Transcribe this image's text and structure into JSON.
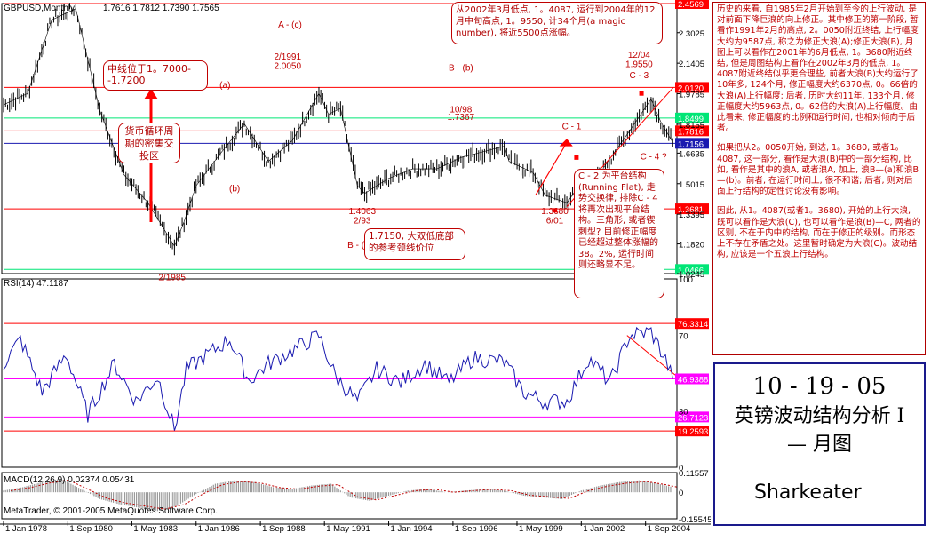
{
  "chart_data": [
    {
      "type": "line",
      "panel": "price",
      "symbol": "GBPUSD,Monthly",
      "ohlc_text": "1.7616 1.7812 1.7390 1.7565",
      "y_ticks": [
        "2.3025",
        "2.1405",
        "1.9785",
        "1.8165",
        "1.6635",
        "1.5015",
        "1.3395",
        "1.1820",
        "1.0245"
      ],
      "ylim": [
        1.0245,
        2.4569
      ],
      "x": [
        1978,
        1979,
        1980,
        1981,
        1982,
        1983,
        1984,
        1985.1,
        1985.5,
        1986,
        1987,
        1988,
        1989,
        1990,
        1991.1,
        1991.5,
        1992,
        1992.7,
        1993,
        1994,
        1995,
        1996,
        1997,
        1998.8,
        1999,
        2000,
        2000.5,
        2001.4,
        2001.8,
        2002.2,
        2003,
        2004,
        2004.9,
        2005.3,
        2005.8
      ],
      "values": [
        1.92,
        1.98,
        2.37,
        2.43,
        1.89,
        1.55,
        1.4,
        1.17,
        1.3,
        1.49,
        1.66,
        1.82,
        1.62,
        1.73,
        1.98,
        1.87,
        1.9,
        1.49,
        1.45,
        1.53,
        1.58,
        1.58,
        1.64,
        1.7,
        1.62,
        1.56,
        1.44,
        1.4,
        1.47,
        1.44,
        1.6,
        1.78,
        1.95,
        1.83,
        1.72
      ],
      "h_levels": [
        {
          "value": 2.4569,
          "label": "2.4569",
          "color": "#ff0000"
        },
        {
          "value": 2.012,
          "label": "2.0120",
          "color": "#ff0000"
        },
        {
          "value": 1.8499,
          "label": "1.8499",
          "color": "#00e676"
        },
        {
          "value": 1.7816,
          "label": "1.7816",
          "color": "#ff0000"
        },
        {
          "value": 1.7156,
          "label": "1.7156",
          "color": "#1a1ab0"
        },
        {
          "value": 1.3681,
          "label": "1.3681",
          "color": "#ff0000"
        },
        {
          "value": 1.0466,
          "label": "1.0466",
          "color": "#00e676"
        }
      ],
      "annotations": [
        {
          "text": "A - (c)",
          "x": 1989.9,
          "y": 2.33
        },
        {
          "text": "2/1991",
          "x": 1989.8,
          "y": 2.16
        },
        {
          "text": "2.0050",
          "x": 1989.8,
          "y": 2.11
        },
        {
          "text": "(a)",
          "x": 1987.2,
          "y": 2.01
        },
        {
          "text": "(b)",
          "x": 1987.6,
          "y": 1.46
        },
        {
          "text": "B - (b)",
          "x": 1997.0,
          "y": 2.1
        },
        {
          "text": "10/98",
          "x": 1997.0,
          "y": 1.88
        },
        {
          "text": "1.7367",
          "x": 1997.0,
          "y": 1.84
        },
        {
          "text": "C - 1",
          "x": 2001.6,
          "y": 1.79
        },
        {
          "text": "12/04",
          "x": 2004.4,
          "y": 2.17
        },
        {
          "text": "1.9550",
          "x": 2004.4,
          "y": 2.12
        },
        {
          "text": "C - 3",
          "x": 2004.4,
          "y": 2.06
        },
        {
          "text": "C - 4 ?",
          "x": 2005.0,
          "y": 1.63
        },
        {
          "text": "C - 2",
          "x": 2003.6,
          "y": 1.48
        },
        {
          "text": "1.4063",
          "x": 1992.9,
          "y": 1.34
        },
        {
          "text": "2/93",
          "x": 1992.9,
          "y": 1.29
        },
        {
          "text": "B - (a)",
          "x": 1992.8,
          "y": 1.16
        },
        {
          "text": "1.3680",
          "x": 2000.9,
          "y": 1.34
        },
        {
          "text": "6/01",
          "x": 2000.9,
          "y": 1.29
        },
        {
          "text": "1.4087",
          "x": 2002.4,
          "y": 1.34
        },
        {
          "text": "3/02",
          "x": 2002.4,
          "y": 1.29
        },
        {
          "text": "B - (c)",
          "x": 2002.6,
          "y": 1.14
        },
        {
          "text": "2/1985",
          "x": 1985.0,
          "y": 0.99
        }
      ],
      "notes": {
        "mid_line": "中线位于1。7000--1.7200",
        "cycle": "货币循环周期的密集交投区",
        "neckline": "1.7150, 大双低底部的参考颈线价位",
        "c2_note": "C - 2 为平台结构(Running Flat), 走势交换律, 排除C - 4 将再次出现平台结构。三角形, 或者锲刺型? 目前修正幅度已经超过整体涨幅的 38。2%, 运行时间则还略显不足。",
        "top_note": "从2002年3月低点, 1。4087, 运行到2004年的12月中旬高点, 1。9550, 计34个月(a magic number), 将近5500点涨幅。"
      }
    },
    {
      "type": "line",
      "panel": "rsi",
      "title": "RSI(14) 47.1187",
      "y_ticks": [
        "100",
        "70",
        "30",
        "0"
      ],
      "ylim": [
        0,
        100
      ],
      "levels": [
        {
          "value": 76.3314,
          "label": "76.3314",
          "color": "#ff0000"
        },
        {
          "value": 46.9388,
          "label": "46.9388",
          "color": "#ff00ff"
        },
        {
          "value": 26.7123,
          "label": "26.7123",
          "color": "#ff00ff"
        },
        {
          "value": 19.2593,
          "label": "19.2593",
          "color": "#ff0000"
        }
      ],
      "x": [
        1978,
        1978.7,
        1979.6,
        1980.6,
        1981.5,
        1982.6,
        1983.5,
        1984.4,
        1985.1,
        1985.6,
        1986.5,
        1987.4,
        1988.2,
        1989.0,
        1990.0,
        1991.1,
        1991.8,
        1992.7,
        1993.5,
        1994.5,
        1995.5,
        1996.5,
        1997.5,
        1998.8,
        1999.6,
        2000.4,
        2001.4,
        2002.3,
        2003.2,
        2004.0,
        2004.9,
        2005.5,
        2005.8
      ],
      "values": [
        55,
        68,
        40,
        60,
        28,
        55,
        35,
        48,
        20,
        52,
        60,
        68,
        46,
        55,
        62,
        70,
        48,
        35,
        52,
        45,
        55,
        45,
        58,
        56,
        40,
        35,
        35,
        58,
        45,
        70,
        72,
        57,
        47
      ]
    },
    {
      "type": "bar",
      "panel": "macd",
      "title": "MACD(12,26,9) 0.02374 0.05431",
      "y_ticks": [
        "0.11557",
        "0",
        "-0.15545"
      ],
      "ylim": [
        -0.15545,
        0.11557
      ],
      "x": [
        1978,
        1978.8,
        1979.6,
        1980.4,
        1981.2,
        1982.0,
        1982.8,
        1983.6,
        1984.4,
        1985.2,
        1986.0,
        1986.8,
        1987.6,
        1988.4,
        1989.2,
        1990.0,
        1990.8,
        1991.6,
        1992.4,
        1993.2,
        1994.0,
        1994.8,
        1995.6,
        1996.4,
        1997.2,
        1998.0,
        1998.8,
        1999.6,
        2000.4,
        2001.2,
        2002.0,
        2002.8,
        2003.6,
        2004.4,
        2005.2,
        2005.8
      ],
      "values": [
        0.01,
        0.03,
        0.06,
        0.08,
        0.02,
        -0.04,
        -0.07,
        -0.09,
        -0.11,
        -0.08,
        -0.01,
        0.05,
        0.07,
        0.06,
        0.03,
        0.02,
        0.04,
        0.05,
        -0.03,
        -0.05,
        -0.02,
        0.01,
        0.02,
        0.0,
        0.01,
        0.02,
        0.01,
        -0.02,
        -0.03,
        -0.04,
        0.01,
        0.04,
        0.06,
        0.07,
        0.05,
        0.03
      ]
    }
  ],
  "x_axis_labels": [
    "1 Jan 1978",
    "1 Sep 1980",
    "1 May 1983",
    "1 Jan 1986",
    "1 Sep 1988",
    "1 May 1991",
    "1 Jan 1994",
    "1 Sep 1996",
    "1 May 1999",
    "1 Jan 2002",
    "1 Sep 2004"
  ],
  "copyright": "MetaTrader, © 2001-2005 MetaQuotes Software Corp.",
  "right_text": [
    "历史的来看, 自1985年2月开始到至今的上行波动, 是对前面下降巨浪的向上修正。其中修正的第一阶段, 暂看作1991年2月的高点, 2。0050附近终结, 上行幅度大约为9587点, 称之为修正大浪(A);修正大浪(B), 月图上可以看作在2001年的6月低点, 1。3680附近终结, 但是周图结构上看作在2002年3月的低点, 1。4087附近终结似乎更合理些, 前者大浪(B)大约运行了10年多, 124个月, 修正幅度大约6370点, 0。66倍的大浪(A)上行幅度; 后者, 历时大约11年, 133个月, 修正幅度大约5963点, 0。62倍的大浪(A)上行幅度。由此看来, 修正幅度的比例和运行时间, 也相对倾向于后者。",
    "如果把从2。0050开始, 到达, 1。3680, 或者1。4087, 这一部分, 看作是大浪(B)中的一部分结构, 比如, 看作是其中的浪A, 或者浪A, 加上, 浪B—(a)和浪B—(b)。前者, 在运行时间上, 很不和谐; 后者, 则对后面上行结构的定性讨论没有影响。",
    "因此, 从1。4087(或者1。3680), 开始的上行大浪, 既可以看作是大浪(C), 也可以看作是浪(B)—C, 两者的区别, 不在于内中的结构, 而在于修正的级别。而形态上不存在矛盾之处。这里暂时确定为大浪(C)。波动结构, 应该是一个五浪上行结构。"
  ],
  "title_box": {
    "date": "10 - 19 - 05",
    "line1": "英镑波动结构分析 I",
    "line2": "— 月图",
    "author": "Sharkeater"
  }
}
